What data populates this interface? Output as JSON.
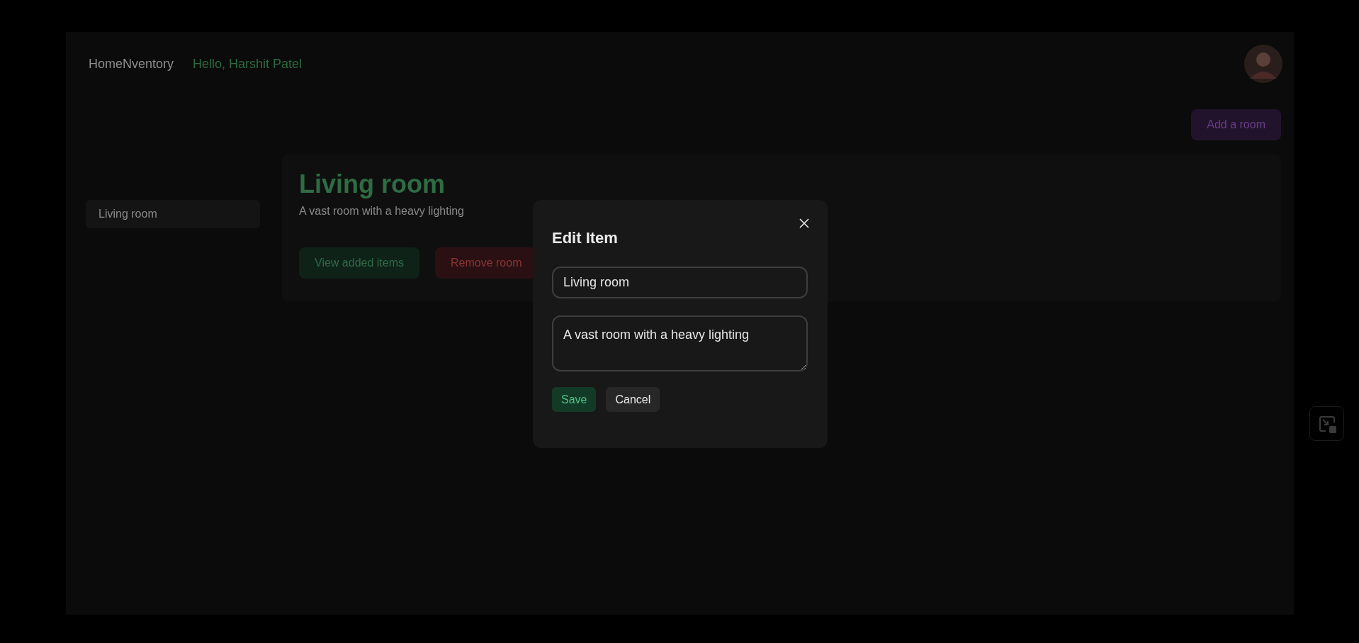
{
  "header": {
    "brand": "HomeNventory",
    "greeting": "Hello, Harshit Patel"
  },
  "add_button": {
    "label": "Add a room"
  },
  "sidebar": {
    "items": [
      {
        "label": "Living room"
      }
    ]
  },
  "room_card": {
    "title": "Living room",
    "description": "A vast room with a heavy lighting",
    "buttons": [
      {
        "label": "View added items",
        "kind": "view"
      },
      {
        "label": "Remove room",
        "kind": "remove"
      }
    ]
  },
  "modal": {
    "title": "Edit Item",
    "fields": [
      {
        "kind": "input",
        "value": "Living room"
      },
      {
        "kind": "textarea",
        "value": "A vast room with a heavy lighting"
      }
    ],
    "buttons": [
      {
        "label": "Save",
        "kind": "primary"
      },
      {
        "label": "Cancel",
        "kind": "secondary"
      }
    ]
  }
}
